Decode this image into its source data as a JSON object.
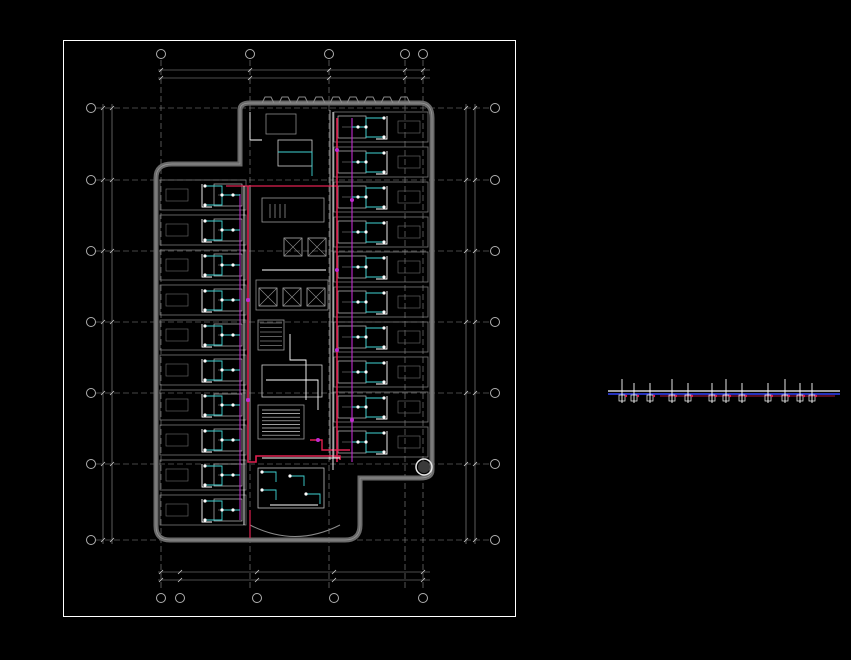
{
  "drawing": {
    "view": "floor-plan-drainage-layout",
    "background_color": "#000000",
    "frame_color": "#ffffff",
    "grid_color": "#8c8c8c",
    "wall_color": "#6a6a6a",
    "room_line_color": "#bfbfbf",
    "branch_pipe_color": "#3fd3d3",
    "main_pipe_color": "#e02050",
    "riser_color": "#c02ad0",
    "fixture_color": "#ffffff",
    "section_line_colors": [
      "#2a3ad8",
      "#ffffff",
      "#e02050"
    ]
  }
}
